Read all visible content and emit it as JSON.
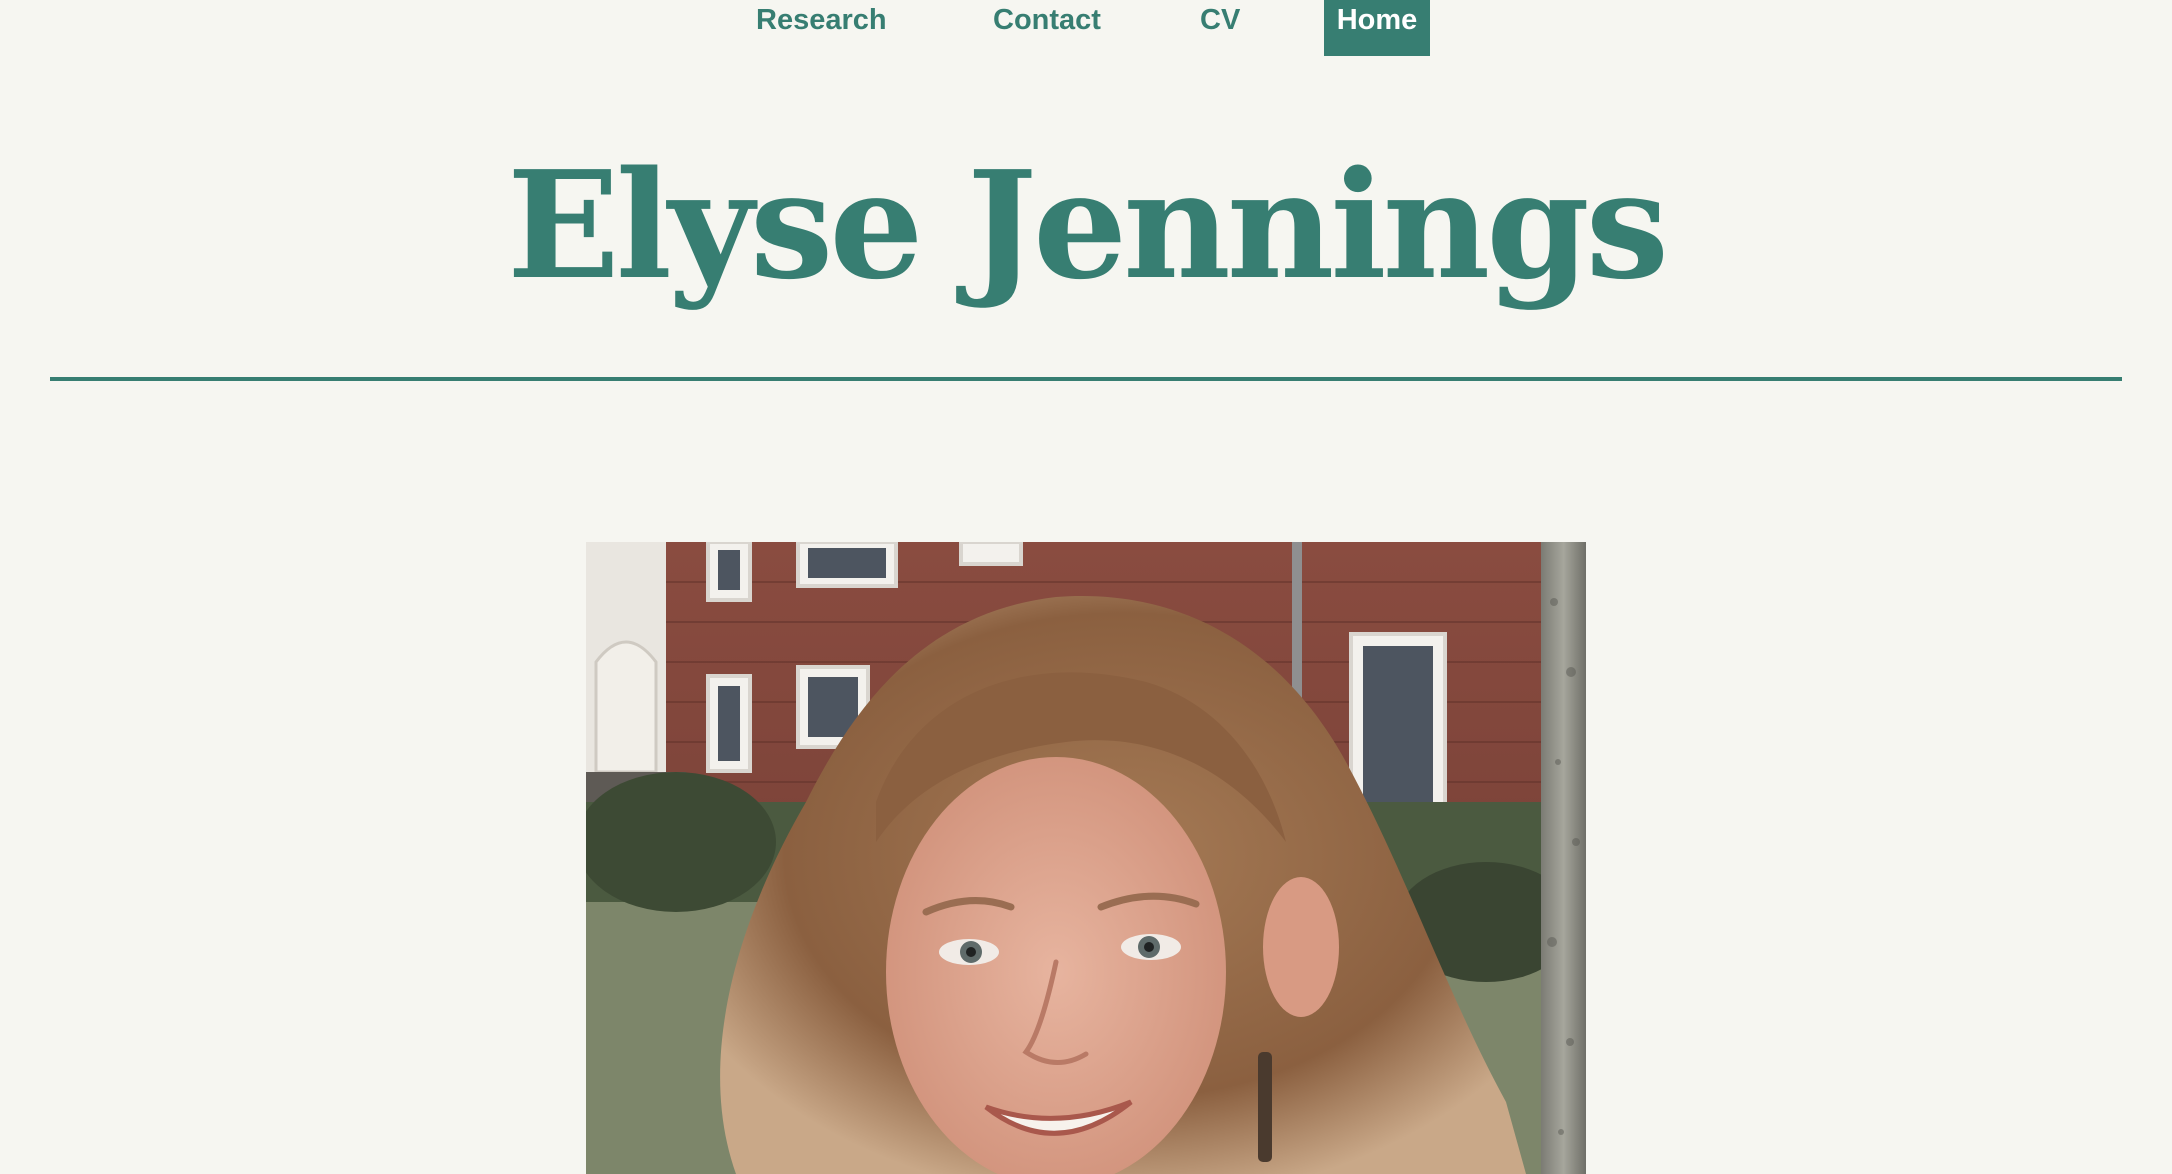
{
  "nav": {
    "items": [
      {
        "label": "Research"
      },
      {
        "label": "Contact"
      },
      {
        "label": "CV"
      },
      {
        "label": "Home",
        "active": true
      }
    ]
  },
  "header": {
    "title": "Elyse Jennings"
  },
  "colors": {
    "accent": "#377e72",
    "background": "#f6f6f1"
  },
  "portrait": {
    "subject": "profile-photo"
  }
}
